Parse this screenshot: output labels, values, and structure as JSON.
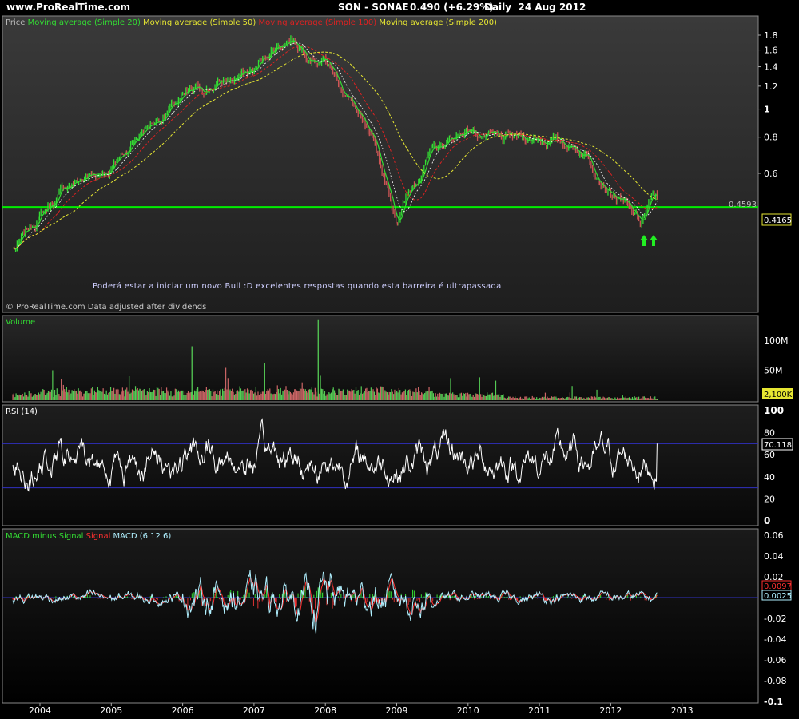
{
  "header": {
    "site": "www.ProRealTime.com",
    "instrument": "SON - SONAE",
    "price": "0.490 (+6.29%)",
    "period": "Daily",
    "date": "24 Aug 2012"
  },
  "colors": {
    "background": "#000000",
    "panel_top": "#3a3a3a",
    "panel_bottom": "#000000",
    "price_up": "#33dd33",
    "price_down": "#cc5555",
    "sma20": "#33dd33",
    "sma50": "#e6e632",
    "sma100": "#dd2222",
    "sma200": "#e6e632",
    "support_line": "#00ee00",
    "rsi_line": "#ffffff",
    "rsi_levels": "#3030c0",
    "macd_line": "#b0f0ff",
    "signal_line": "#ff3030"
  },
  "price_panel": {
    "legend": [
      {
        "text": "Price",
        "color": "#bbbbbb"
      },
      {
        "text": " Moving average (Simple 20)",
        "color": "#33dd33"
      },
      {
        "text": " Moving average (Simple 50)",
        "color": "#e6e632"
      },
      {
        "text": " Moving average (Simple 100)",
        "color": "#dd2222"
      },
      {
        "text": " Moving average (Simple 200)",
        "color": "#e6e632"
      }
    ],
    "y_ticks": [
      "1.8",
      "1.6",
      "1.4",
      "1.2",
      "1",
      "0.8",
      "0.6"
    ],
    "support_value": "0.4593",
    "last_value_box": "0.4165",
    "annotation": "Poderá estar a iniciar um novo Bull :D excelentes respostas quando esta barreira é ultrapassada",
    "copyright": "© ProRealTime.com  Data adjusted after dividends",
    "arrow_icons": [
      "up-arrow-icon",
      "up-arrow-icon"
    ]
  },
  "volume_panel": {
    "title": "Volume",
    "y_ticks": [
      "100M",
      "50M"
    ],
    "last_value_box": "2,100K"
  },
  "rsi_panel": {
    "title": "RSI (14)",
    "y_ticks": [
      "100",
      "80",
      "60",
      "40",
      "20",
      "0"
    ],
    "last_value_box": "70.118"
  },
  "macd_panel": {
    "legend": [
      {
        "text": "MACD minus Signal",
        "color": "#33dd33"
      },
      {
        "text": " Signal",
        "color": "#ff3030"
      },
      {
        "text": " MACD (6 12 6)",
        "color": "#b0f0ff"
      }
    ],
    "y_ticks": [
      "0.06",
      "0.04",
      "0.02",
      "-0.02",
      "-0.04",
      "-0.06",
      "-0.08",
      "-0.1"
    ],
    "value_box_signal": "0.0097",
    "value_box_macd": "0.0025"
  },
  "x_axis": {
    "labels": [
      "2004",
      "2005",
      "2006",
      "2007",
      "2008",
      "2009",
      "2010",
      "2011",
      "2012",
      "2013"
    ]
  },
  "chart_data": [
    {
      "type": "line",
      "title": "SON - SONAE",
      "x": [
        "2003-09",
        "2004-01",
        "2004-06",
        "2005-01",
        "2005-06",
        "2006-01",
        "2006-06",
        "2007-01",
        "2007-04",
        "2007-07",
        "2007-10",
        "2008-01",
        "2008-06",
        "2008-10",
        "2009-01",
        "2009-06",
        "2010-01",
        "2010-06",
        "2011-01",
        "2011-06",
        "2011-09",
        "2012-01",
        "2012-06",
        "2012-08"
      ],
      "series": [
        {
          "name": "Price",
          "values": [
            0.33,
            0.43,
            0.55,
            0.63,
            0.84,
            1.08,
            1.2,
            1.35,
            1.62,
            1.78,
            1.6,
            1.5,
            1.0,
            0.65,
            0.42,
            0.68,
            0.86,
            0.77,
            0.8,
            0.76,
            0.7,
            0.53,
            0.4,
            0.49
          ]
        }
      ],
      "ylim": [
        0.3,
        1.9
      ],
      "y_scale": "log",
      "reference_line": 0.4593
    },
    {
      "type": "bar",
      "title": "Volume",
      "note": "bar heights estimated",
      "ylim": [
        0,
        150
      ]
    },
    {
      "type": "line",
      "title": "RSI (14)",
      "ylim": [
        0,
        100
      ],
      "levels": [
        30,
        70
      ],
      "last": 70.118
    },
    {
      "type": "line",
      "title": "MACD (6 12 6)",
      "ylim": [
        -0.1,
        0.07
      ],
      "last_macd": 0.0025,
      "last_signal": 0.0097
    }
  ]
}
